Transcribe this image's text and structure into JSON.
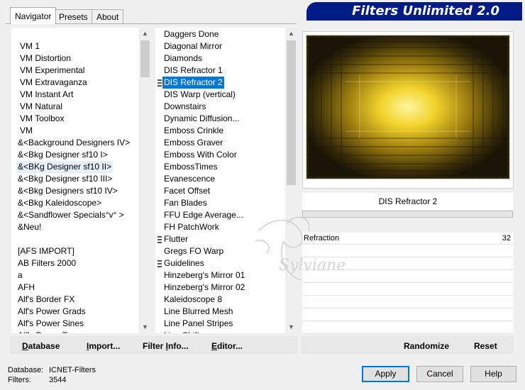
{
  "app_title": "Filters Unlimited 2.0",
  "tabs": [
    {
      "label": "Navigator",
      "active": true
    },
    {
      "label": "Presets",
      "active": false
    },
    {
      "label": "About",
      "active": false
    }
  ],
  "categories": [
    "VM 1",
    "VM Distortion",
    "VM Experimental",
    "VM Extravaganza",
    "VM Instant Art",
    "VM Natural",
    "VM Toolbox",
    "VM",
    "&<Background Designers IV>",
    "&<Bkg Designer sf10 I>",
    "&<BKg Designer sf10 II>",
    "&<Bkg Designer sf10 III>",
    "&<Bkg Designers sf10 IV>",
    "&<Bkg Kaleidoscope>",
    "&<Sandflower Specials°v° >",
    "&Neu!",
    "",
    "[AFS IMPORT]",
    "AB Filters 2000",
    "a",
    "AFH",
    "Alf's Border FX",
    "Alf's Power Grads",
    "Alf's Power Sines",
    "Alf's Power Toys"
  ],
  "categories_hover_index": 10,
  "filters": [
    "Daggers Done",
    "Diagonal Mirror",
    "Diamonds",
    "DIS Refractor 1",
    "DIS Refractor 2",
    "DIS Warp (vertical)",
    "Downstairs",
    "Dynamic Diffusion...",
    "Emboss Crinkle",
    "Emboss Graver",
    "Emboss With Color",
    "EmbossTimes",
    "Evanescence",
    "Facet Offset",
    "Fan Blades",
    "FFU Edge Average...",
    "FH PatchWork",
    "Flutter",
    "Gregs FO Warp",
    "Guidelines",
    "Hinzeberg's Mirror 01",
    "Hinzeberg's Mirror 02",
    "Kaleidoscope 8",
    "Line Blurred Mesh",
    "Line Panel Stripes",
    "Line Shift..."
  ],
  "filters_selected_index": 4,
  "filters_marker_indices": [
    4,
    17,
    19
  ],
  "selected_filter_title": "DIS Refractor 2",
  "params": [
    {
      "label": "Refraction",
      "value": "32"
    }
  ],
  "left_commands": [
    {
      "label": "Database",
      "ul": "D",
      "rest": "atabase"
    },
    {
      "label": "Import...",
      "ul": "I",
      "rest": "mport..."
    },
    {
      "label": "Filter Info...",
      "pre": "Filter ",
      "ul": "I",
      "rest": "nfo..."
    },
    {
      "label": "Editor...",
      "ul": "E",
      "rest": "ditor..."
    }
  ],
  "right_commands": {
    "randomize": "Randomize",
    "reset": "Reset"
  },
  "status": {
    "database_label": "Database:",
    "database_value": "ICNET-Filters",
    "filters_label": "Filters:",
    "filters_value": "3544"
  },
  "buttons": {
    "apply": "Apply",
    "cancel": "Cancel",
    "help": "Help"
  },
  "watermark_text": "Sylviane",
  "colors": {
    "banner": "#001a86",
    "selection": "#0078d7",
    "preview_bg": "#2a2410"
  }
}
